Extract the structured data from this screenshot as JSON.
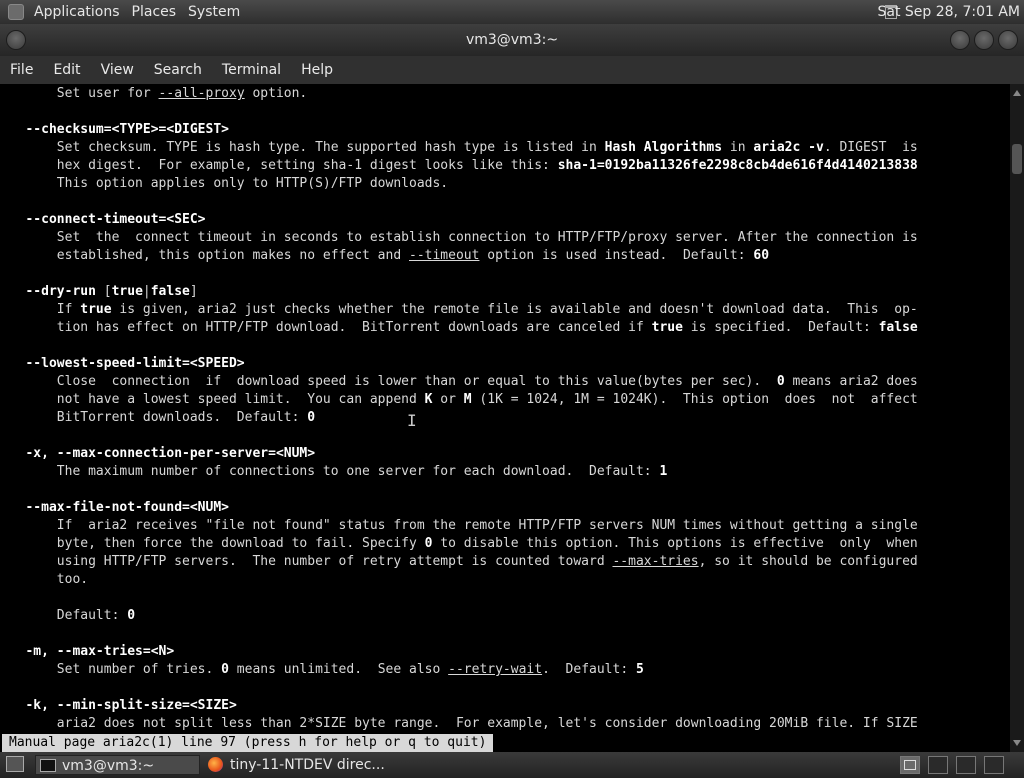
{
  "top_panel": {
    "menus": [
      "Applications",
      "Places",
      "System"
    ],
    "clock": "Sat Sep 28,  7:01 AM"
  },
  "window": {
    "title": "vm3@vm3:~"
  },
  "menubar": [
    "File",
    "Edit",
    "View",
    "Search",
    "Terminal",
    "Help"
  ],
  "manpage": {
    "lines": [
      [
        [
          "       Set user for ",
          ""
        ],
        [
          "--all-proxy",
          "u"
        ],
        [
          " option.",
          ""
        ]
      ],
      [],
      [
        [
          "   ",
          ""
        ],
        [
          "--checksum=<TYPE>=<DIGEST>",
          "b"
        ]
      ],
      [
        [
          "       Set checksum. TYPE is hash type. The supported hash type is listed in ",
          ""
        ],
        [
          "Hash Algorithms",
          "b"
        ],
        [
          " in ",
          ""
        ],
        [
          "aria2c -v",
          "b"
        ],
        [
          ". DIGEST  is",
          ""
        ]
      ],
      [
        [
          "       hex digest.  For example, setting sha-1 digest looks like this: ",
          ""
        ],
        [
          "sha-1=0192ba11326fe2298c8cb4de616f4d4140213838",
          "b"
        ]
      ],
      [
        [
          "       This option applies only to HTTP(S)/FTP downloads.",
          ""
        ]
      ],
      [],
      [
        [
          "   ",
          ""
        ],
        [
          "--connect-timeout=<SEC>",
          "b"
        ]
      ],
      [
        [
          "       Set  the  connect timeout in seconds to establish connection to HTTP/FTP/proxy server. After the connection is",
          ""
        ]
      ],
      [
        [
          "       established, this option makes no effect and ",
          ""
        ],
        [
          "--timeout",
          "u"
        ],
        [
          " option is used instead.  Default: ",
          ""
        ],
        [
          "60",
          "b"
        ]
      ],
      [],
      [
        [
          "   ",
          ""
        ],
        [
          "--dry-run",
          "b"
        ],
        [
          " [",
          ""
        ],
        [
          "true",
          "b"
        ],
        [
          "|",
          ""
        ],
        [
          "false",
          "b"
        ],
        [
          "]",
          ""
        ]
      ],
      [
        [
          "       If ",
          ""
        ],
        [
          "true",
          "b"
        ],
        [
          " is given, aria2 just checks whether the remote file is available and doesn't download data.  This  op-",
          ""
        ]
      ],
      [
        [
          "       tion has effect on HTTP/FTP download.  BitTorrent downloads are canceled if ",
          ""
        ],
        [
          "true",
          "b"
        ],
        [
          " is specified.  Default: ",
          ""
        ],
        [
          "false",
          "b"
        ]
      ],
      [],
      [
        [
          "   ",
          ""
        ],
        [
          "--lowest-speed-limit=<SPEED>",
          "b"
        ]
      ],
      [
        [
          "       Close  connection  if  download speed is lower than or equal to this value(bytes per sec).  ",
          ""
        ],
        [
          "0",
          "b"
        ],
        [
          " means aria2 does",
          ""
        ]
      ],
      [
        [
          "       not have a lowest speed limit.  You can append ",
          ""
        ],
        [
          "K",
          "b"
        ],
        [
          " or ",
          ""
        ],
        [
          "M",
          "b"
        ],
        [
          " (1K = 1024, 1M = 1024K).  This option  does  not  affect",
          ""
        ]
      ],
      [
        [
          "       BitTorrent downloads.  Default: ",
          ""
        ],
        [
          "0",
          "b"
        ]
      ],
      [],
      [
        [
          "   ",
          ""
        ],
        [
          "-x, --max-connection-per-server=<NUM>",
          "b"
        ]
      ],
      [
        [
          "       The maximum number of connections to one server for each download.  Default: ",
          ""
        ],
        [
          "1",
          "b"
        ]
      ],
      [],
      [
        [
          "   ",
          ""
        ],
        [
          "--max-file-not-found=<NUM>",
          "b"
        ]
      ],
      [
        [
          "       If  aria2 receives \"file not found\" status from the remote HTTP/FTP servers NUM times without getting a single",
          ""
        ]
      ],
      [
        [
          "       byte, then force the download to fail. Specify ",
          ""
        ],
        [
          "0",
          "b"
        ],
        [
          " to disable this option. This options is effective  only  when",
          ""
        ]
      ],
      [
        [
          "       using HTTP/FTP servers.  The number of retry attempt is counted toward ",
          ""
        ],
        [
          "--max-tries",
          "u"
        ],
        [
          ", so it should be configured",
          ""
        ]
      ],
      [
        [
          "       too.",
          ""
        ]
      ],
      [],
      [
        [
          "       Default: ",
          ""
        ],
        [
          "0",
          "b"
        ]
      ],
      [],
      [
        [
          "   ",
          ""
        ],
        [
          "-m, --max-tries=<N>",
          "b"
        ]
      ],
      [
        [
          "       Set number of tries. ",
          ""
        ],
        [
          "0",
          "b"
        ],
        [
          " means unlimited.  See also ",
          ""
        ],
        [
          "--retry-wait",
          "u"
        ],
        [
          ".  Default: ",
          ""
        ],
        [
          "5",
          "b"
        ]
      ],
      [],
      [
        [
          "   ",
          ""
        ],
        [
          "-k, --min-split-size=<SIZE>",
          "b"
        ]
      ],
      [
        [
          "       aria2 does not split less than 2*SIZE byte range.  For example, let's consider downloading 20MiB file. If SIZE",
          ""
        ]
      ]
    ]
  },
  "status_line": "Manual page aria2c(1) line 97 (press h for help or q to quit)",
  "taskbar": {
    "tasks": [
      "vm3@vm3:~",
      "tiny-11-NTDEV direc..."
    ]
  }
}
